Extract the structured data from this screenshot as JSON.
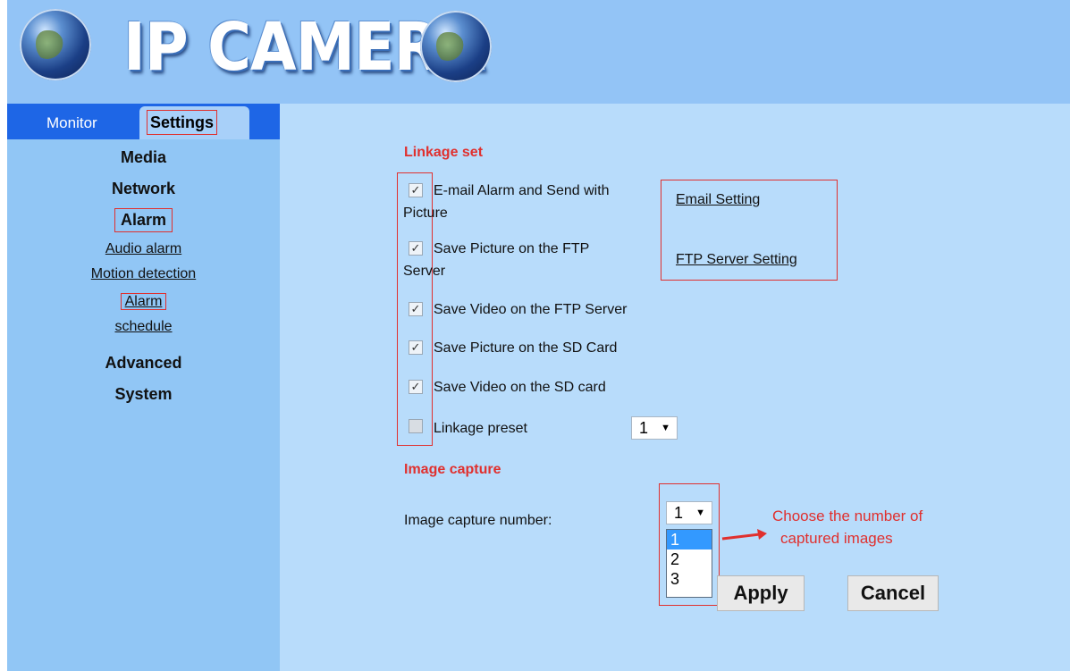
{
  "header": {
    "logo_text": "IP CAMERA"
  },
  "tabs": {
    "monitor": "Monitor",
    "settings": "Settings"
  },
  "nav": {
    "media": "Media",
    "network": "Network",
    "alarm": "Alarm",
    "audio_alarm": "Audio alarm",
    "motion_detection": "Motion detection",
    "alarm_schedule_line1": "Alarm",
    "alarm_schedule_line2": "schedule",
    "advanced": "Advanced",
    "system": "System"
  },
  "linkage": {
    "title": "Linkage set",
    "options": [
      {
        "line1": "E-mail Alarm and Send with",
        "line2": "Picture",
        "checked": true
      },
      {
        "line1": "Save Picture on the FTP",
        "line2": "Server",
        "checked": true
      },
      {
        "line1": "Save Video on the FTP Server",
        "checked": true
      },
      {
        "line1": "Save Picture on the SD Card",
        "checked": true
      },
      {
        "line1": "Save Video on the SD card",
        "checked": true
      },
      {
        "line1": "Linkage preset",
        "checked": false
      }
    ],
    "email_setting": "Email Setting",
    "ftp_setting": "FTP Server Setting",
    "preset_value": "1"
  },
  "capture": {
    "title": "Image capture",
    "label": "Image capture number:",
    "value": "1",
    "options": [
      "1",
      "2",
      "3"
    ]
  },
  "buttons": {
    "apply": "Apply",
    "cancel": "Cancel"
  },
  "annotation": {
    "line1": "Choose the number of",
    "line2": "captured images"
  },
  "colors": {
    "accent_red": "#e0302e",
    "tab_blue": "#1e66e6",
    "nav_bg": "#91c6f5",
    "main_bg": "#b8dcfb",
    "selected_blue": "#3399ff"
  }
}
